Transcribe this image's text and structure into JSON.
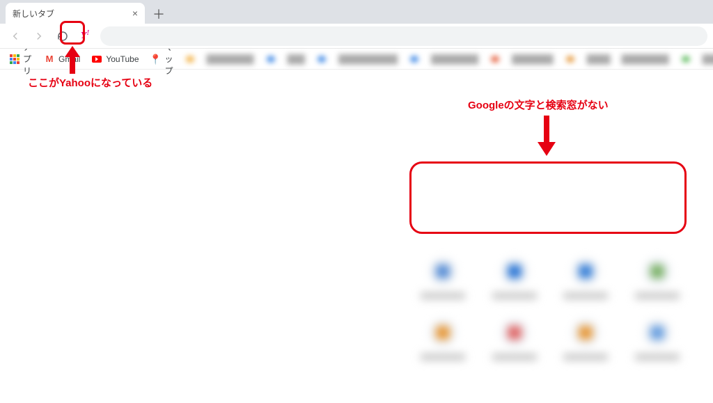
{
  "tab": {
    "title": "新しいタブ"
  },
  "toolbar": {
    "search_engine_icon_label": "Y!",
    "search_engine_name": "Yahoo"
  },
  "bookmarks": {
    "apps_label": "アプリ",
    "items": [
      {
        "label": "Gmail",
        "icon": "gmail"
      },
      {
        "label": "YouTube",
        "icon": "youtube"
      },
      {
        "label": "マップ",
        "icon": "maps"
      }
    ]
  },
  "annotations": {
    "left": "ここがYahooになっている",
    "right": "Googleの文字と検索窓がない"
  },
  "shortcut_colors": [
    "#5a8fd6",
    "#2e78d6",
    "#3a81d8",
    "#7db36a",
    "#e79a3c",
    "#e06a6a",
    "#e79a3c",
    "#6aa0e0"
  ]
}
